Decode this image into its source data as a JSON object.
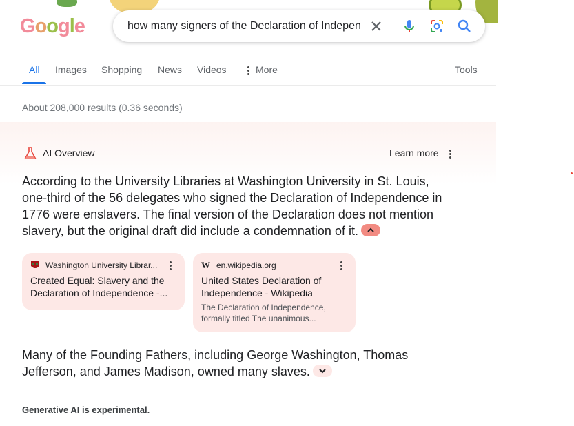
{
  "logo": {
    "letters": [
      "G",
      "o",
      "o",
      "g",
      "l",
      "e"
    ]
  },
  "search": {
    "query": "how many signers of the Declaration of Indepen",
    "clear_icon": "close-icon",
    "voice_icon": "mic-icon",
    "lens_icon": "camera-lens-icon",
    "search_icon": "search-icon"
  },
  "tabs": {
    "all": "All",
    "images": "Images",
    "shopping": "Shopping",
    "news": "News",
    "videos": "Videos",
    "more": "More",
    "tools": "Tools"
  },
  "stats": "About 208,000 results (0.36 seconds)",
  "ai_overview": {
    "title": "AI Overview",
    "learn_more": "Learn more",
    "lines1": [
      "According to the University Libraries at Washington University in St. Louis,",
      "one-third of the 56 delegates who signed the Declaration of Independence in",
      "1776 were enslavers. The final version of the Declaration does not mention",
      "slavery, but the original draft did include a condemnation of it."
    ],
    "cards": [
      {
        "site": "Washington University Librar...",
        "title_lines": [
          "Created Equal: Slavery and the",
          "Declaration of Independence -..."
        ],
        "snippet_lines": []
      },
      {
        "site": "en.wikipedia.org",
        "title_lines": [
          "United States Declaration of",
          "Independence - Wikipedia"
        ],
        "snippet_lines": [
          "The Declaration of Independence,",
          "formally titled The unanimous..."
        ]
      }
    ],
    "lines2": [
      "Many of the Founding Fathers, including George Washington, Thomas",
      "Jefferson, and James Madison, owned many slaves."
    ],
    "disclaimer": "Generative AI is experimental."
  },
  "colors": {
    "accent": "#1a73e8",
    "card_bg": "#fde8e6",
    "chevron_active_bg": "#f28b82"
  }
}
